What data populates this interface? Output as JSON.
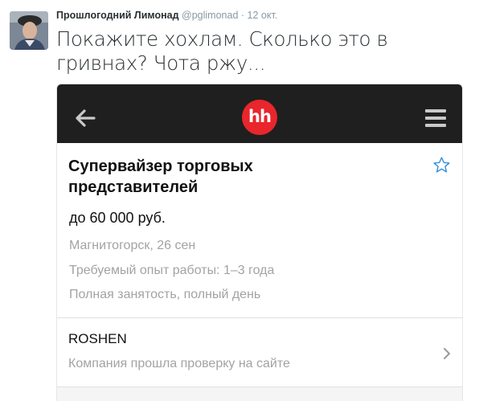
{
  "tweet": {
    "author_name": "Прошлогодний Лимонад",
    "author_handle": "@pglimonad",
    "separator": "·",
    "time": "12 окт.",
    "text": "Покажите хохлам. Сколько это в гривнах? Чота ржу..."
  },
  "screenshot": {
    "logo_text": "hh",
    "vacancy": {
      "title": "Супервайзер торговых представителей",
      "salary": "до 60 000 руб.",
      "location_date": "Магнитогорск, 26 сен",
      "experience": "Требуемый опыт работы: 1–3 года",
      "employment": "Полная занятость, полный день"
    },
    "company": {
      "name": "ROSHEN",
      "verified_text": "Компания прошла проверку на сайте"
    }
  },
  "colors": {
    "app_bar": "#1f1f1f",
    "logo_red": "#e8262b",
    "star_blue": "#3a8fd9"
  },
  "icons": [
    "back-arrow-icon",
    "menu-icon",
    "star-icon",
    "chevron-right-icon"
  ]
}
